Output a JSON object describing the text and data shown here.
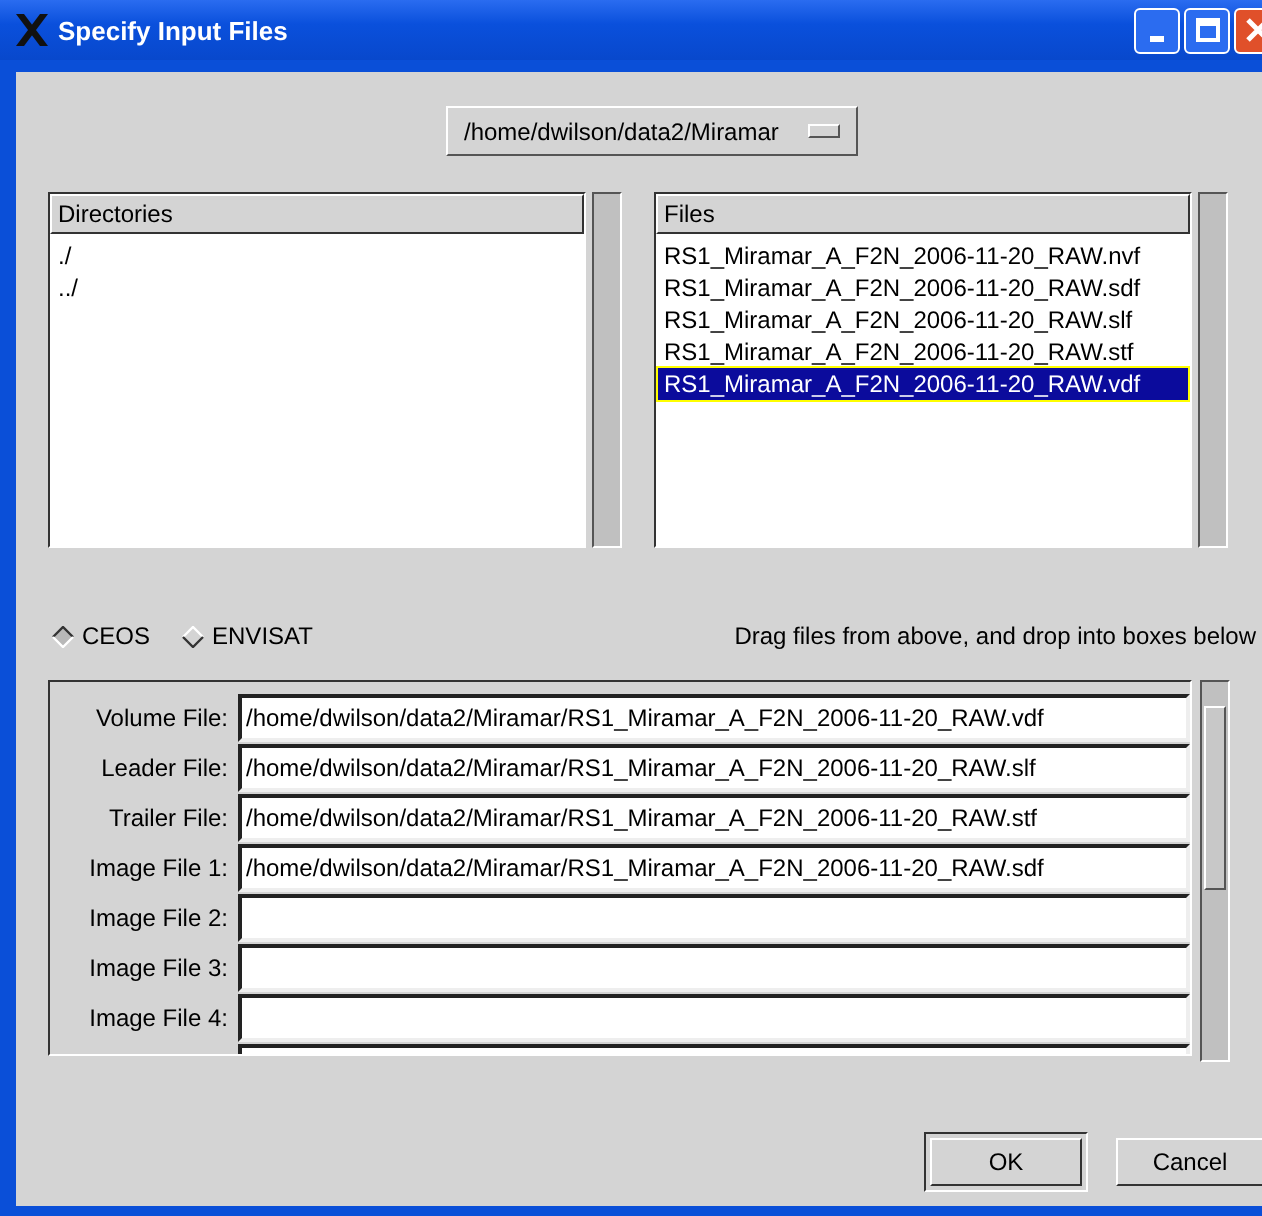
{
  "window": {
    "title": "Specify Input Files"
  },
  "directory_menu": {
    "label": "/home/dwilson/data2/Miramar"
  },
  "directories": {
    "header": "Directories",
    "items": [
      {
        "label": "./",
        "selected": false
      },
      {
        "label": "../",
        "selected": false
      }
    ]
  },
  "files": {
    "header": "Files",
    "items": [
      {
        "label": "RS1_Miramar_A_F2N_2006-11-20_RAW.nvf",
        "selected": false
      },
      {
        "label": "RS1_Miramar_A_F2N_2006-11-20_RAW.sdf",
        "selected": false
      },
      {
        "label": "RS1_Miramar_A_F2N_2006-11-20_RAW.slf",
        "selected": false
      },
      {
        "label": "RS1_Miramar_A_F2N_2006-11-20_RAW.stf",
        "selected": false
      },
      {
        "label": "RS1_Miramar_A_F2N_2006-11-20_RAW.vdf",
        "selected": true
      }
    ]
  },
  "formats": [
    {
      "label": "CEOS",
      "selected": true
    },
    {
      "label": "ENVISAT",
      "selected": false
    }
  ],
  "hint": "Drag files from above, and drop into boxes below",
  "fields": [
    {
      "label": "Volume File:",
      "value": "/home/dwilson/data2/Miramar/RS1_Miramar_A_F2N_2006-11-20_RAW.vdf"
    },
    {
      "label": "Leader File:",
      "value": "/home/dwilson/data2/Miramar/RS1_Miramar_A_F2N_2006-11-20_RAW.slf"
    },
    {
      "label": "Trailer File:",
      "value": "/home/dwilson/data2/Miramar/RS1_Miramar_A_F2N_2006-11-20_RAW.stf"
    },
    {
      "label": "Image File 1:",
      "value": "/home/dwilson/data2/Miramar/RS1_Miramar_A_F2N_2006-11-20_RAW.sdf"
    },
    {
      "label": "Image File 2:"
    },
    {
      "label": "Image File 3:"
    },
    {
      "label": "Image File 4:"
    }
  ],
  "buttons": [
    {
      "label": "OK",
      "default": true
    },
    {
      "label": "Cancel",
      "default": false
    }
  ]
}
